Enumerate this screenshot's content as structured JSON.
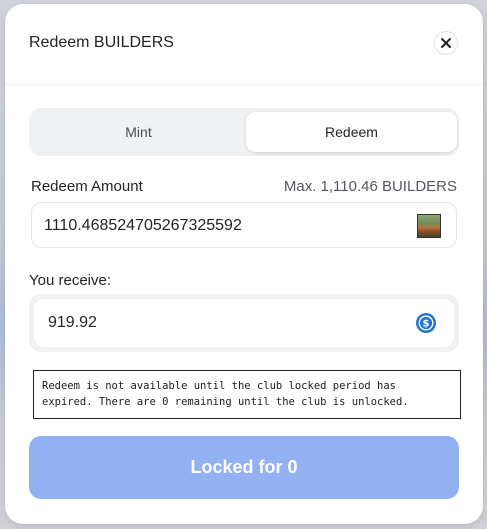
{
  "modal": {
    "title": "Redeem BUILDERS",
    "close_icon": "close-icon"
  },
  "tabs": [
    {
      "label": "Mint",
      "active": false
    },
    {
      "label": "Redeem",
      "active": true
    }
  ],
  "redeem_amount": {
    "label": "Redeem Amount",
    "max_text": "Max. 1,110.46 BUILDERS",
    "value": "1110.468524705267325592",
    "token_icon": "builders-token-icon"
  },
  "receive": {
    "label": "You receive:",
    "value": "919.92",
    "token_icon": "usdc-icon"
  },
  "notice": {
    "line1": "Redeem is not available until the club locked period has",
    "line2": "expired. There are 0 remaining until the club is unlocked."
  },
  "action_button": {
    "label": "Locked for 0",
    "disabled": true
  },
  "colors": {
    "button_disabled": "#93b0f2",
    "usdc_blue": "#2775ca"
  }
}
